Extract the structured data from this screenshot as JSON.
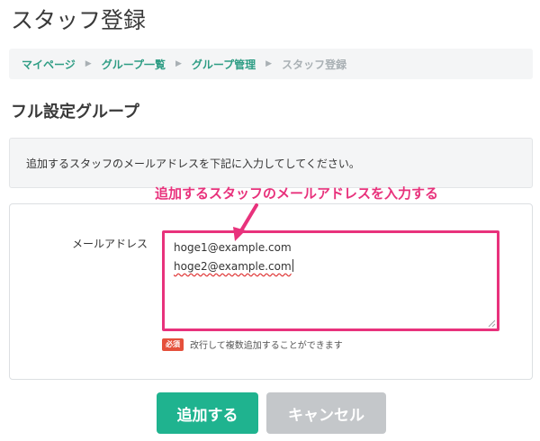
{
  "page": {
    "title": "スタッフ登録"
  },
  "breadcrumb": {
    "items": [
      "マイページ",
      "グループ一覧",
      "グループ管理"
    ],
    "current": "スタッフ登録",
    "separator": "▶"
  },
  "section": {
    "title": "フル設定グループ"
  },
  "notice": {
    "text": "追加するスタッフのメールアドレスを下記に入力してしてください。"
  },
  "annotation": {
    "text": "追加するスタッフのメールアドレスを入力する",
    "color": "#e8327c"
  },
  "form": {
    "email_label": "メールアドレス",
    "email_lines": [
      "hoge1@example.com",
      "hoge2@example.com"
    ],
    "required_badge": "必須",
    "hint": "改行して複数追加することができます"
  },
  "actions": {
    "add_label": "追加する",
    "cancel_label": "キャンセル"
  },
  "colors": {
    "accent": "#1fb38f",
    "link": "#2e9d84",
    "highlight": "#e8327c",
    "required": "#e5503b",
    "disabled": "#c4c7ca"
  }
}
